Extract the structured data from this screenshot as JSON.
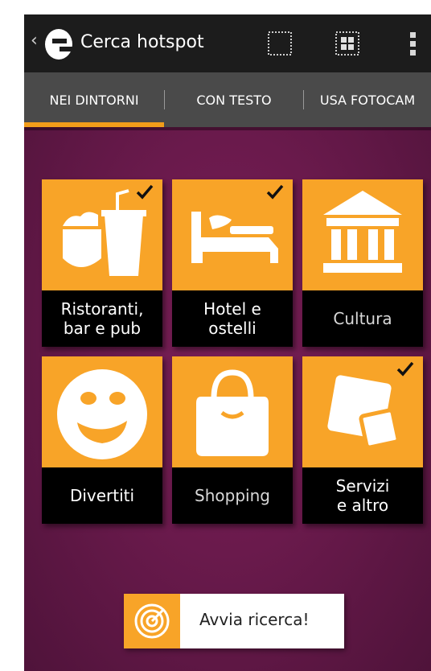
{
  "app": {
    "title": "Cerca hotspot",
    "back_icon": "chevron-left-icon",
    "logo": "e-logo-icon"
  },
  "actionbar": {
    "icons": [
      "select-area-icon",
      "grid-icon",
      "overflow-menu-icon"
    ]
  },
  "tabs": [
    {
      "label": "NEI DINTORNI",
      "selected": true
    },
    {
      "label": "CON TESTO",
      "selected": false
    },
    {
      "label": "USA FOTOCAM",
      "selected": false
    }
  ],
  "categories": [
    {
      "label": "Ristoranti,\nbar e pub",
      "icon": "restaurant-icon",
      "checked": true
    },
    {
      "label": "Hotel e\nostelli",
      "icon": "bed-icon",
      "checked": true
    },
    {
      "label": "Cultura",
      "icon": "museum-icon",
      "checked": false
    },
    {
      "label": "Divertiti",
      "icon": "smiley-icon",
      "checked": false
    },
    {
      "label": "Shopping",
      "icon": "shopping-bag-icon",
      "checked": false
    },
    {
      "label": "Servizi\ne altro",
      "icon": "services-icon",
      "checked": true
    }
  ],
  "search_button": {
    "label": "Avvia ricerca!",
    "icon": "radar-icon"
  },
  "colors": {
    "accent": "#f8a428",
    "background": "#5e1844",
    "actionbar": "#1c1c1c",
    "tabbar": "#4a4a4a",
    "tab_indicator": "#f29d1a"
  }
}
